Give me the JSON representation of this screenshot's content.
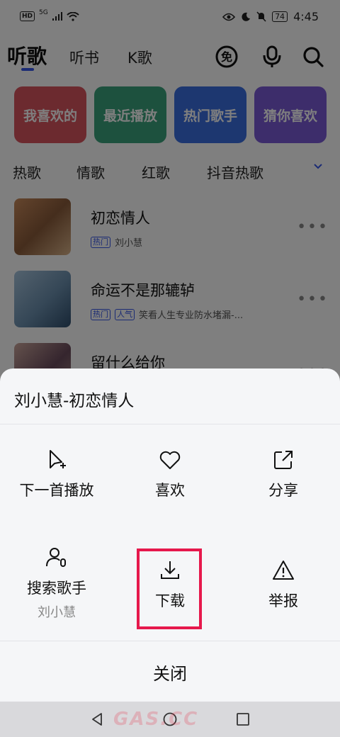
{
  "status": {
    "time": "4:45",
    "battery": "74",
    "hd": "HD",
    "network": "5G"
  },
  "header": {
    "tabs": [
      {
        "label": "听歌",
        "active": true
      },
      {
        "label": "听书"
      },
      {
        "label": "K歌"
      }
    ],
    "free_badge": "免",
    "accent": "#3757e9"
  },
  "cards": [
    {
      "label": "我喜欢的",
      "color": "#d8545f"
    },
    {
      "label": "最近播放",
      "color": "#3ba27c"
    },
    {
      "label": "热门歌手",
      "color": "#3b6fe0"
    },
    {
      "label": "猜你喜欢",
      "color": "#7b5ad6"
    }
  ],
  "genres": [
    "热歌",
    "情歌",
    "红歌",
    "抖音热歌"
  ],
  "songs": [
    {
      "title": "初恋情人",
      "badges": [
        "热门"
      ],
      "artist": "刘小慧"
    },
    {
      "title": "命运不是那辘轳",
      "badges": [
        "热门",
        "人气"
      ],
      "artist": "笑看人生专业防水堵漏-..."
    },
    {
      "title": "留什么给你",
      "badges": [],
      "artist": ""
    }
  ],
  "sheet": {
    "title": "刘小慧-初恋情人",
    "actions": [
      {
        "label": "下一首播放",
        "icon": "play-next-icon"
      },
      {
        "label": "喜欢",
        "icon": "heart-icon"
      },
      {
        "label": "分享",
        "icon": "share-icon"
      },
      {
        "label": "搜索歌手",
        "sub": "刘小慧",
        "icon": "search-singer-icon"
      },
      {
        "label": "下载",
        "icon": "download-icon"
      },
      {
        "label": "举报",
        "icon": "report-icon"
      }
    ],
    "close": "关闭",
    "highlight_color": "#e6184c"
  },
  "watermark": "GAS.CC"
}
